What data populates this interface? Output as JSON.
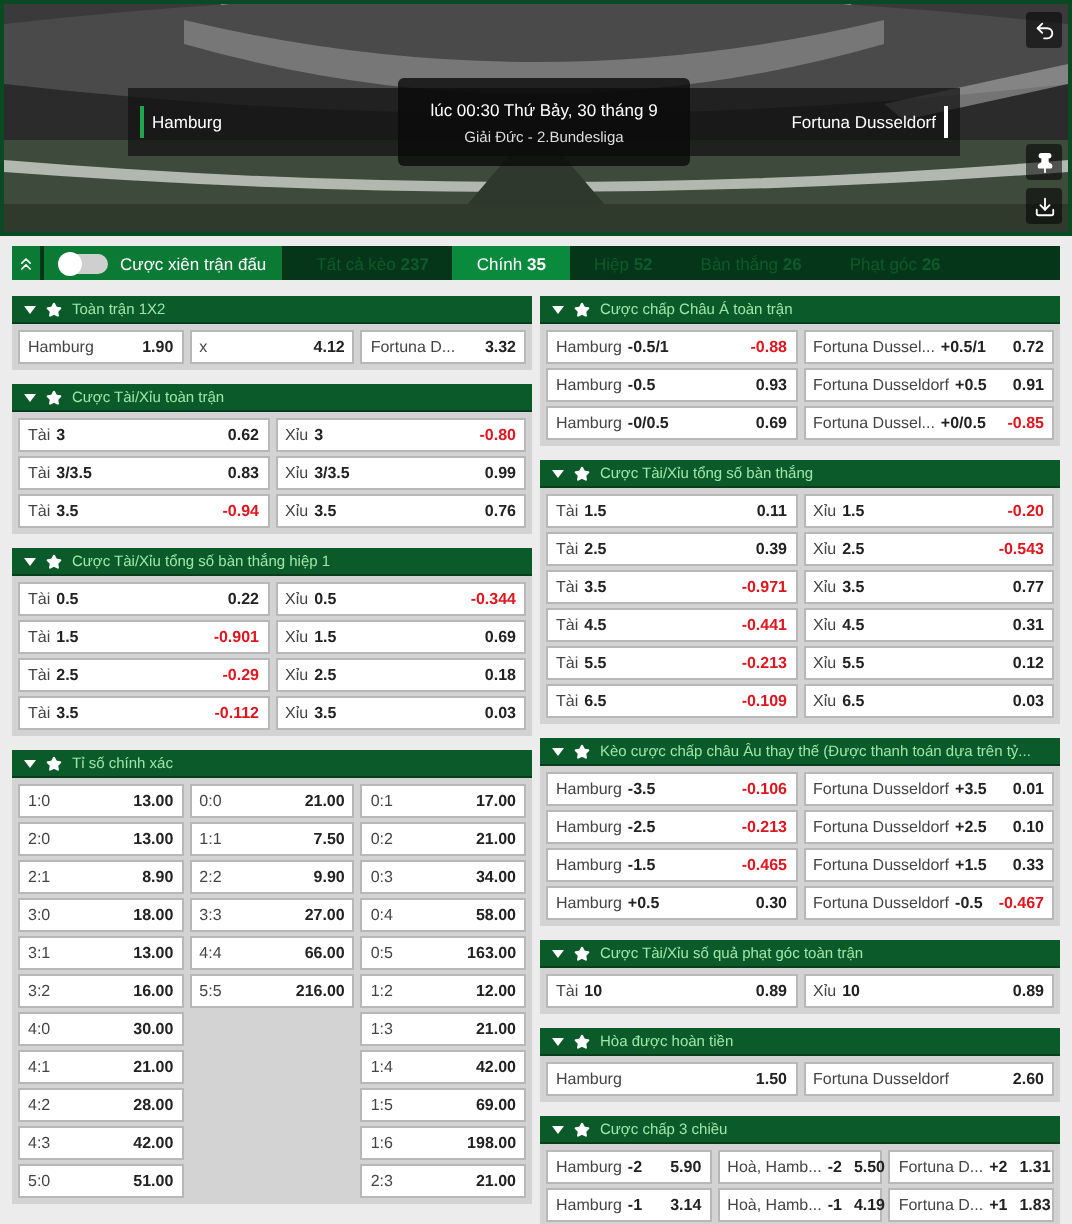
{
  "match": {
    "home": "Hamburg",
    "away": "Fortuna Dusseldorf",
    "time": "lúc 00:30 Thứ Bảy, 30 tháng 9",
    "league": "Giải Đức - 2.Bundesliga"
  },
  "toolbar": {
    "parlay": {
      "label": "Cược xiên trận đấu",
      "on": false
    }
  },
  "tabs": [
    {
      "label": "Tất cả kèo",
      "count": "237",
      "selected": false
    },
    {
      "label": "Chính",
      "count": "35",
      "selected": true
    },
    {
      "label": "Hiệp",
      "count": "52",
      "selected": false
    },
    {
      "label": "Bàn thắng",
      "count": "26",
      "selected": false
    },
    {
      "label": "Phạt góc",
      "count": "26",
      "selected": false
    }
  ],
  "left_column": [
    {
      "title": "Toàn trận 1X2",
      "expanded": true,
      "kind": "rows",
      "rows": [
        [
          {
            "label": "Hamburg",
            "odds": "1.90",
            "negative": false
          },
          {
            "label": "x",
            "odds": "4.12",
            "negative": false
          },
          {
            "label": "Fortuna D...",
            "odds": "3.32",
            "negative": false
          }
        ]
      ]
    },
    {
      "title": "Cược Tài/Xỉu toàn trận",
      "expanded": true,
      "kind": "rows",
      "rows": [
        [
          {
            "label": "Tài",
            "line": "3",
            "odds": "0.62",
            "negative": false
          },
          {
            "label": "Xỉu",
            "line": "3",
            "odds": "-0.80",
            "negative": true
          }
        ],
        [
          {
            "label": "Tài",
            "line": "3/3.5",
            "odds": "0.83",
            "negative": false
          },
          {
            "label": "Xỉu",
            "line": "3/3.5",
            "odds": "0.99",
            "negative": false
          }
        ],
        [
          {
            "label": "Tài",
            "line": "3.5",
            "odds": "-0.94",
            "negative": true
          },
          {
            "label": "Xỉu",
            "line": "3.5",
            "odds": "0.76",
            "negative": false
          }
        ]
      ]
    },
    {
      "title": "Cược Tài/Xỉu tổng số bàn thắng hiệp 1",
      "expanded": true,
      "kind": "rows",
      "rows": [
        [
          {
            "label": "Tài",
            "line": "0.5",
            "odds": "0.22",
            "negative": false
          },
          {
            "label": "Xỉu",
            "line": "0.5",
            "odds": "-0.344",
            "negative": true
          }
        ],
        [
          {
            "label": "Tài",
            "line": "1.5",
            "odds": "-0.901",
            "negative": true
          },
          {
            "label": "Xỉu",
            "line": "1.5",
            "odds": "0.69",
            "negative": false
          }
        ],
        [
          {
            "label": "Tài",
            "line": "2.5",
            "odds": "-0.29",
            "negative": true
          },
          {
            "label": "Xỉu",
            "line": "2.5",
            "odds": "0.18",
            "negative": false
          }
        ],
        [
          {
            "label": "Tài",
            "line": "3.5",
            "odds": "-0.112",
            "negative": true
          },
          {
            "label": "Xỉu",
            "line": "3.5",
            "odds": "0.03",
            "negative": false
          }
        ]
      ]
    },
    {
      "title": "Tỉ số chính xác",
      "expanded": true,
      "kind": "columns",
      "columns": [
        [
          {
            "label": "1:0",
            "odds": "13.00",
            "negative": false
          },
          {
            "label": "2:0",
            "odds": "13.00",
            "negative": false
          },
          {
            "label": "2:1",
            "odds": "8.90",
            "negative": false
          },
          {
            "label": "3:0",
            "odds": "18.00",
            "negative": false
          },
          {
            "label": "3:1",
            "odds": "13.00",
            "negative": false
          },
          {
            "label": "3:2",
            "odds": "16.00",
            "negative": false
          },
          {
            "label": "4:0",
            "odds": "30.00",
            "negative": false
          },
          {
            "label": "4:1",
            "odds": "21.00",
            "negative": false
          },
          {
            "label": "4:2",
            "odds": "28.00",
            "negative": false
          },
          {
            "label": "4:3",
            "odds": "42.00",
            "negative": false
          },
          {
            "label": "5:0",
            "odds": "51.00",
            "negative": false
          }
        ],
        [
          {
            "label": "0:0",
            "odds": "21.00",
            "negative": false
          },
          {
            "label": "1:1",
            "odds": "7.50",
            "negative": false
          },
          {
            "label": "2:2",
            "odds": "9.90",
            "negative": false
          },
          {
            "label": "3:3",
            "odds": "27.00",
            "negative": false
          },
          {
            "label": "4:4",
            "odds": "66.00",
            "negative": false
          },
          {
            "label": "5:5",
            "odds": "216.00",
            "negative": false
          }
        ],
        [
          {
            "label": "0:1",
            "odds": "17.00",
            "negative": false
          },
          {
            "label": "0:2",
            "odds": "21.00",
            "negative": false
          },
          {
            "label": "0:3",
            "odds": "34.00",
            "negative": false
          },
          {
            "label": "0:4",
            "odds": "58.00",
            "negative": false
          },
          {
            "label": "0:5",
            "odds": "163.00",
            "negative": false
          },
          {
            "label": "1:2",
            "odds": "12.00",
            "negative": false
          },
          {
            "label": "1:3",
            "odds": "21.00",
            "negative": false
          },
          {
            "label": "1:4",
            "odds": "42.00",
            "negative": false
          },
          {
            "label": "1:5",
            "odds": "69.00",
            "negative": false
          },
          {
            "label": "1:6",
            "odds": "198.00",
            "negative": false
          },
          {
            "label": "2:3",
            "odds": "21.00",
            "negative": false
          }
        ]
      ]
    }
  ],
  "right_column": [
    {
      "title": "Cược chấp Châu Á toàn trận",
      "expanded": true,
      "kind": "rows",
      "rows": [
        [
          {
            "label": "Hamburg",
            "line": "-0.5/1",
            "odds": "-0.88",
            "negative": true
          },
          {
            "label": "Fortuna Dussel...",
            "line": "+0.5/1",
            "odds": "0.72",
            "negative": false
          }
        ],
        [
          {
            "label": "Hamburg",
            "line": "-0.5",
            "odds": "0.93",
            "negative": false
          },
          {
            "label": "Fortuna Dusseldorf",
            "line": "+0.5",
            "odds": "0.91",
            "negative": false
          }
        ],
        [
          {
            "label": "Hamburg",
            "line": "-0/0.5",
            "odds": "0.69",
            "negative": false
          },
          {
            "label": "Fortuna Dussel...",
            "line": "+0/0.5",
            "odds": "-0.85",
            "negative": true
          }
        ]
      ]
    },
    {
      "title": "Cược Tài/Xỉu tổng số bàn thắng",
      "expanded": true,
      "kind": "rows",
      "rows": [
        [
          {
            "label": "Tài",
            "line": "1.5",
            "odds": "0.11",
            "negative": false
          },
          {
            "label": "Xỉu",
            "line": "1.5",
            "odds": "-0.20",
            "negative": true
          }
        ],
        [
          {
            "label": "Tài",
            "line": "2.5",
            "odds": "0.39",
            "negative": false
          },
          {
            "label": "Xỉu",
            "line": "2.5",
            "odds": "-0.543",
            "negative": true
          }
        ],
        [
          {
            "label": "Tài",
            "line": "3.5",
            "odds": "-0.971",
            "negative": true
          },
          {
            "label": "Xỉu",
            "line": "3.5",
            "odds": "0.77",
            "negative": false
          }
        ],
        [
          {
            "label": "Tài",
            "line": "4.5",
            "odds": "-0.441",
            "negative": true
          },
          {
            "label": "Xỉu",
            "line": "4.5",
            "odds": "0.31",
            "negative": false
          }
        ],
        [
          {
            "label": "Tài",
            "line": "5.5",
            "odds": "-0.213",
            "negative": true
          },
          {
            "label": "Xỉu",
            "line": "5.5",
            "odds": "0.12",
            "negative": false
          }
        ],
        [
          {
            "label": "Tài",
            "line": "6.5",
            "odds": "-0.109",
            "negative": true
          },
          {
            "label": "Xỉu",
            "line": "6.5",
            "odds": "0.03",
            "negative": false
          }
        ]
      ]
    },
    {
      "title": "Kèo cược chấp châu Âu thay thế (Được thanh toán dựa trên tỷ...",
      "expanded": true,
      "kind": "rows",
      "rows": [
        [
          {
            "label": "Hamburg",
            "line": "-3.5",
            "odds": "-0.106",
            "negative": true
          },
          {
            "label": "Fortuna Dusseldorf",
            "line": "+3.5",
            "odds": "0.01",
            "negative": false
          }
        ],
        [
          {
            "label": "Hamburg",
            "line": "-2.5",
            "odds": "-0.213",
            "negative": true
          },
          {
            "label": "Fortuna Dusseldorf",
            "line": "+2.5",
            "odds": "0.10",
            "negative": false
          }
        ],
        [
          {
            "label": "Hamburg",
            "line": "-1.5",
            "odds": "-0.465",
            "negative": true
          },
          {
            "label": "Fortuna Dusseldorf",
            "line": "+1.5",
            "odds": "0.33",
            "negative": false
          }
        ],
        [
          {
            "label": "Hamburg",
            "line": "+0.5",
            "odds": "0.30",
            "negative": false
          },
          {
            "label": "Fortuna Dusseldorf",
            "line": "-0.5",
            "odds": "-0.467",
            "negative": true
          }
        ]
      ]
    },
    {
      "title": "Cược Tài/Xỉu số quả phạt góc toàn trận",
      "expanded": true,
      "kind": "rows",
      "rows": [
        [
          {
            "label": "Tài",
            "line": "10",
            "odds": "0.89",
            "negative": false
          },
          {
            "label": "Xỉu",
            "line": "10",
            "odds": "0.89",
            "negative": false
          }
        ]
      ]
    },
    {
      "title": "Hòa được hoàn tiền",
      "expanded": true,
      "kind": "rows",
      "rows": [
        [
          {
            "label": "Hamburg",
            "odds": "1.50",
            "negative": false
          },
          {
            "label": "Fortuna Dusseldorf",
            "odds": "2.60",
            "negative": false
          }
        ]
      ]
    },
    {
      "title": "Cược chấp 3 chiều",
      "expanded": true,
      "kind": "rows",
      "rows": [
        [
          {
            "label": "Hamburg",
            "line": "-2",
            "odds": "5.90",
            "negative": false
          },
          {
            "label": "Hoà, Hamb...",
            "line": "-2",
            "odds": "5.50",
            "negative": false
          },
          {
            "label": "Fortuna D...",
            "line": "+2",
            "odds": "1.31",
            "negative": false
          }
        ],
        [
          {
            "label": "Hamburg",
            "line": "-1",
            "odds": "3.14",
            "negative": false
          },
          {
            "label": "Hoà, Hamb...",
            "line": "-1",
            "odds": "4.19",
            "negative": false
          },
          {
            "label": "Fortuna D...",
            "line": "+1",
            "odds": "1.83",
            "negative": false
          }
        ]
      ]
    }
  ]
}
